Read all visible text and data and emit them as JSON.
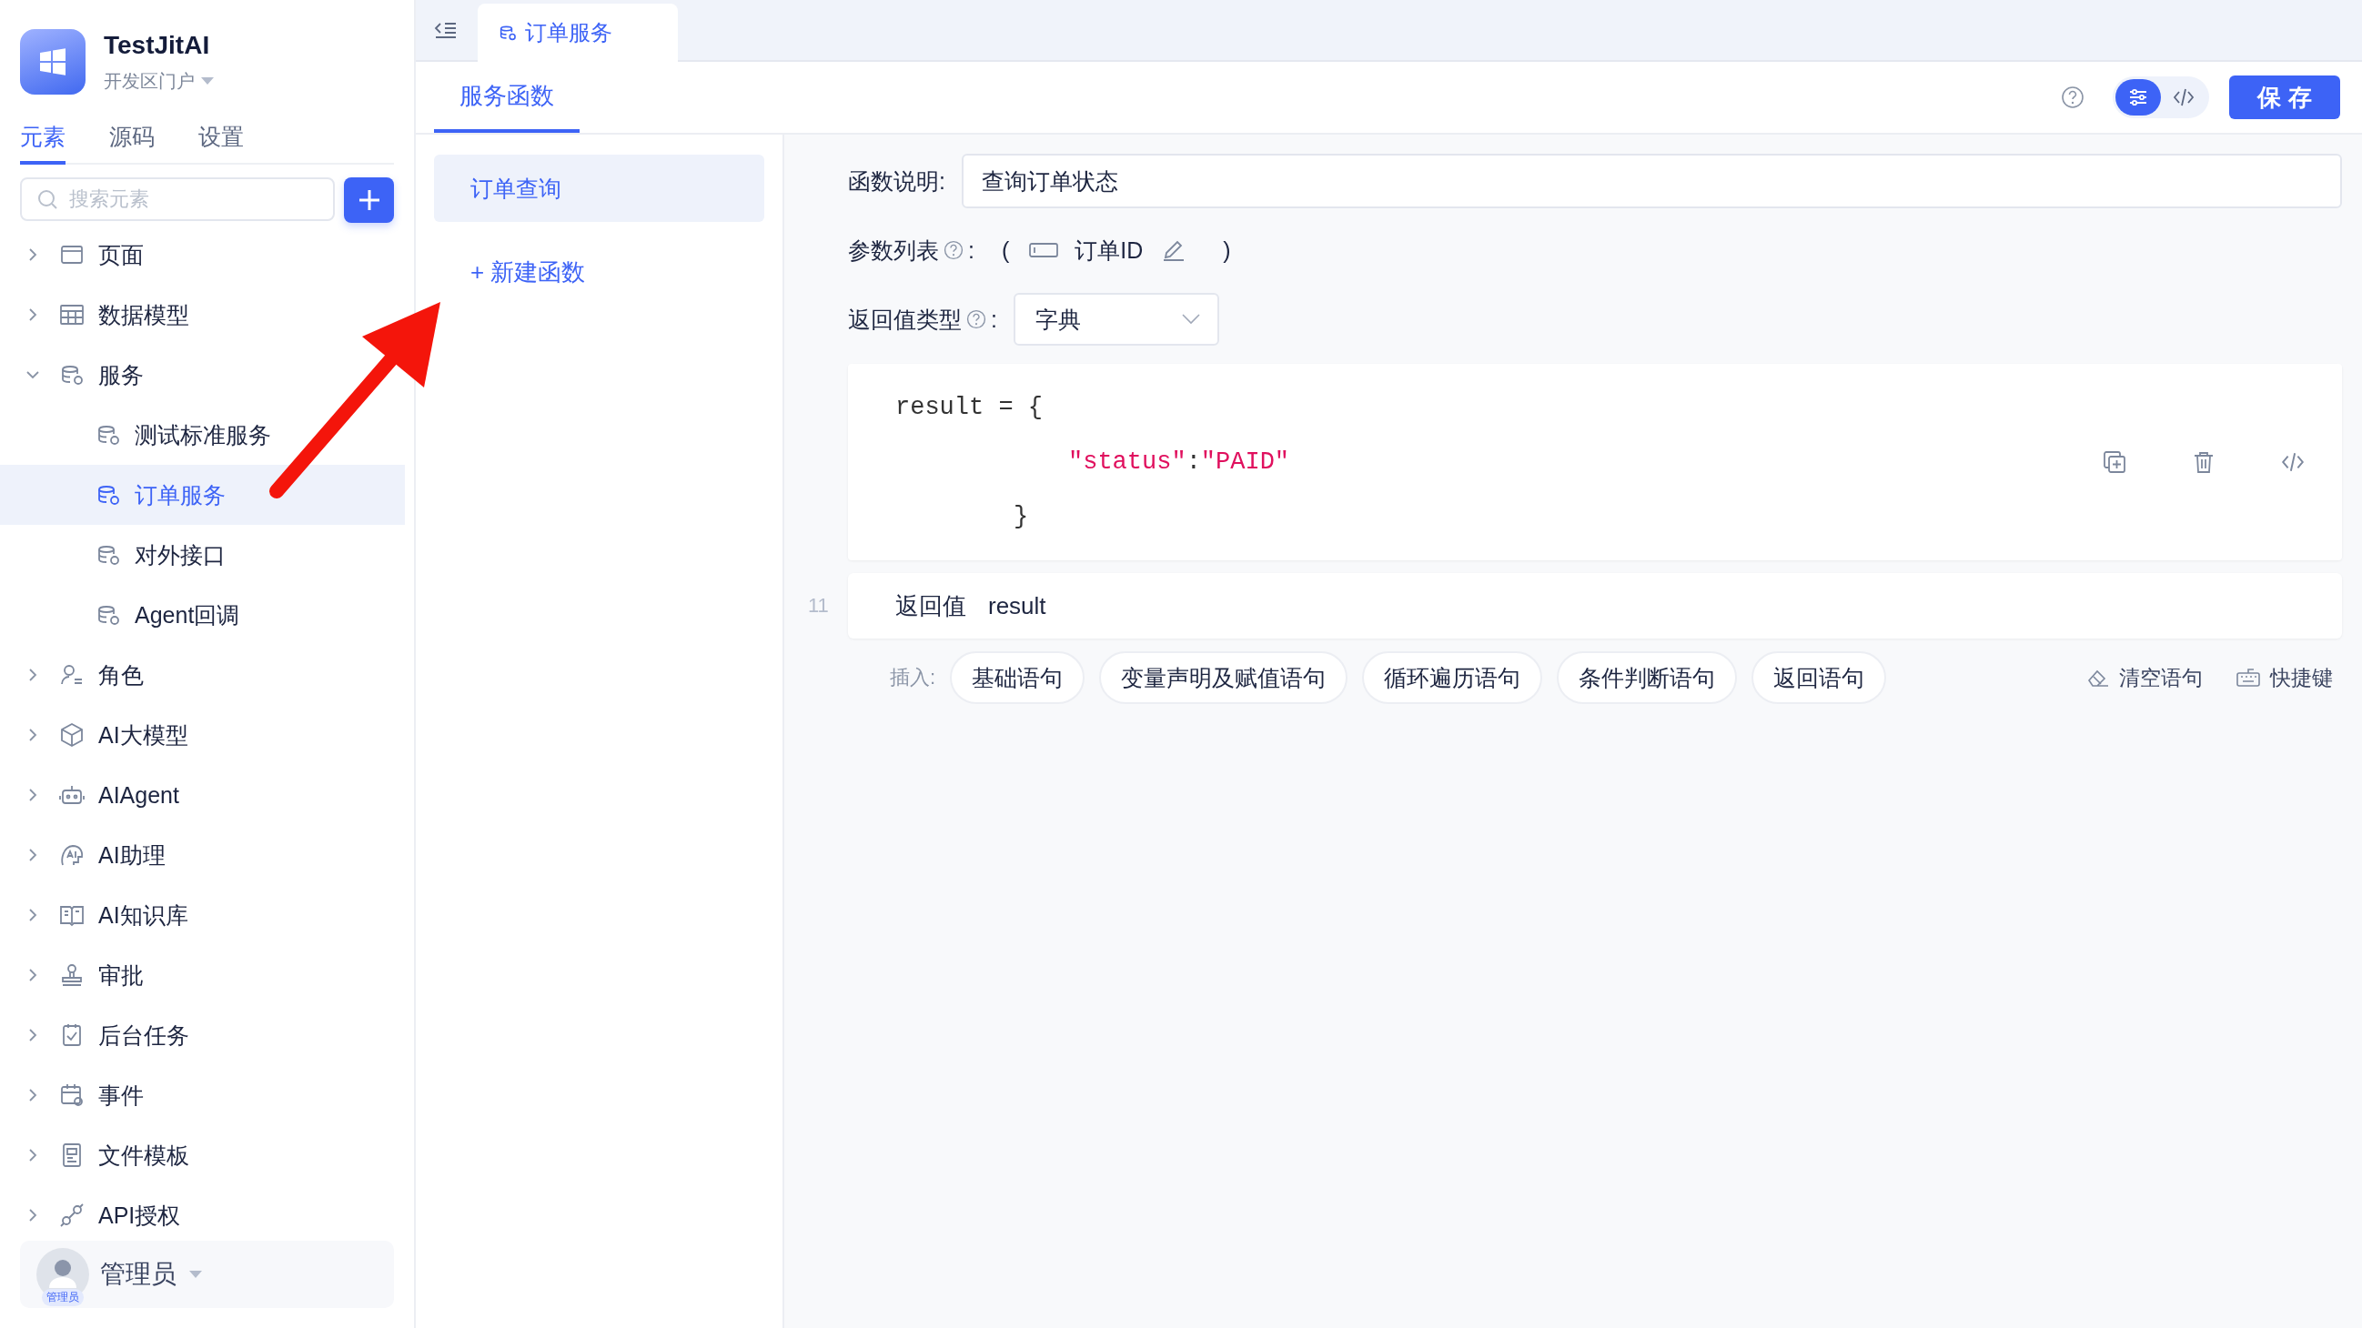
{
  "app": {
    "name": "TestJitAI",
    "portal": "开发区门户"
  },
  "sidebar_tabs": [
    {
      "label": "元素",
      "selected": true
    },
    {
      "label": "源码",
      "selected": false
    },
    {
      "label": "设置",
      "selected": false
    }
  ],
  "search": {
    "placeholder": "搜索元素"
  },
  "tree": [
    {
      "label": "页面",
      "kind": "page",
      "expanded": false,
      "selected": false
    },
    {
      "label": "数据模型",
      "kind": "table",
      "expanded": false,
      "selected": false
    },
    {
      "label": "服务",
      "kind": "service",
      "expanded": true,
      "selected": false,
      "children": [
        {
          "label": "测试标准服务",
          "kind": "service",
          "selected": false
        },
        {
          "label": "订单服务",
          "kind": "service",
          "selected": true
        },
        {
          "label": "对外接口",
          "kind": "service",
          "selected": false
        },
        {
          "label": "Agent回调",
          "kind": "service",
          "selected": false
        }
      ]
    },
    {
      "label": "角色",
      "kind": "role",
      "expanded": false,
      "selected": false
    },
    {
      "label": "AI大模型",
      "kind": "model",
      "expanded": false,
      "selected": false
    },
    {
      "label": "AIAgent",
      "kind": "robot",
      "expanded": false,
      "selected": false
    },
    {
      "label": "AI助理",
      "kind": "assistant",
      "expanded": false,
      "selected": false
    },
    {
      "label": "AI知识库",
      "kind": "book",
      "expanded": false,
      "selected": false
    },
    {
      "label": "审批",
      "kind": "stamp",
      "expanded": false,
      "selected": false
    },
    {
      "label": "后台任务",
      "kind": "task",
      "expanded": false,
      "selected": false
    },
    {
      "label": "事件",
      "kind": "calendar",
      "expanded": false,
      "selected": false
    },
    {
      "label": "文件模板",
      "kind": "doc",
      "expanded": false,
      "selected": false
    },
    {
      "label": "API授权",
      "kind": "plug",
      "expanded": false,
      "selected": false
    }
  ],
  "user": {
    "name": "管理员",
    "badge": "管理员"
  },
  "open_tab": {
    "label": "订单服务"
  },
  "header": {
    "tab": "服务函数",
    "save": "保 存",
    "view_toggle": [
      {
        "kind": "settings",
        "selected": true
      },
      {
        "kind": "code",
        "selected": false
      }
    ]
  },
  "functions": [
    {
      "label": "订单查询",
      "selected": true
    }
  ],
  "new_function": "+ 新建函数",
  "form": {
    "description_label": "函数说明:",
    "description": "查询订单状态",
    "params_label": "参数列表",
    "params_open": "(",
    "params_close": ")",
    "param": "订单ID",
    "return_type_label": "返回值类型",
    "return_type": "字典",
    "colon": ":"
  },
  "code_lines": [
    {
      "kind": "open",
      "tokens": [
        {
          "text": "result = {",
          "kind": "plain"
        }
      ]
    },
    {
      "kind": "entry",
      "tokens": [
        {
          "text": "\"status\"",
          "kind": "string"
        },
        {
          "text": ":",
          "kind": "plain"
        },
        {
          "text": "\"PAID\"",
          "kind": "string"
        }
      ]
    },
    {
      "kind": "close",
      "tokens": [
        {
          "text": "}",
          "kind": "plain"
        }
      ]
    }
  ],
  "return_row": {
    "line_number": "11",
    "keyword": "返回值",
    "value": "result"
  },
  "insert": {
    "label": "插入:",
    "chips": [
      "基础语句",
      "变量声明及赋值语句",
      "循环遍历语句",
      "条件判断语句",
      "返回语句"
    ],
    "clear": "清空语句",
    "shortcuts": "快捷键"
  }
}
